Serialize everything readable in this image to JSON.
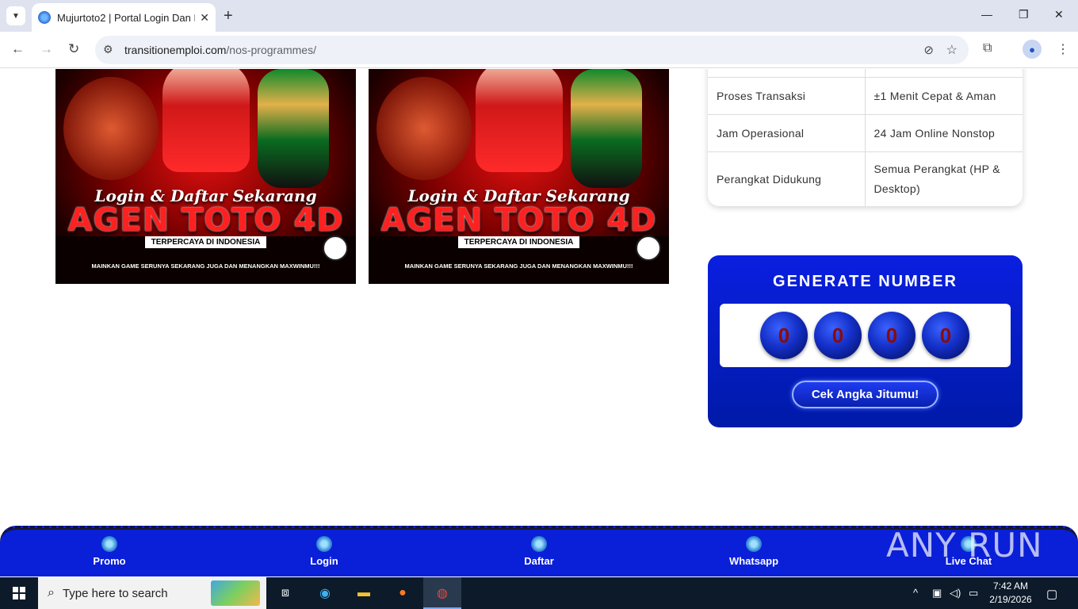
{
  "browser": {
    "tab_title": "Mujurtoto2 | Portal Login Dan D",
    "url_host": "transitionemploi.com",
    "url_path": "/nos-programmes/"
  },
  "banners": [
    {
      "script_text": "Login & Daftar Sekarang",
      "headline": "AGEN TOTO 4D",
      "tagline": "TERPERCAYA DI INDONESIA",
      "footer": "MAINKAN GAME SERUNYA SEKARANG JUGA DAN MENANGKAN MAXWINMU!!!"
    },
    {
      "script_text": "Login & Daftar Sekarang",
      "headline": "AGEN TOTO 4D",
      "tagline": "TERPERCAYA DI INDONESIA",
      "footer": "MAINKAN GAME SERUNYA SEKARANG JUGA DAN MENANGKAN MAXWINMU!!!"
    }
  ],
  "info_table": {
    "rows": [
      {
        "key": "",
        "value": ""
      },
      {
        "key": "Proses Transaksi",
        "value": "±1 Menit Cepat & Aman"
      },
      {
        "key": "Jam Operasional",
        "value": "24 Jam Online Nonstop"
      },
      {
        "key": "Perangkat Didukung",
        "value": "Semua Perangkat (HP & Desktop)"
      }
    ]
  },
  "generator": {
    "title": "GENERATE NUMBER",
    "digits": [
      "0",
      "0",
      "0",
      "0"
    ],
    "button_label": "Cek Angka Jitumu!"
  },
  "bottom_nav": {
    "items": [
      {
        "label": "Promo"
      },
      {
        "label": "Login"
      },
      {
        "label": "Daftar"
      },
      {
        "label": "Whatsapp"
      },
      {
        "label": "Live Chat"
      }
    ]
  },
  "watermark": "ANY RUN",
  "taskbar": {
    "search_placeholder": "Type here to search",
    "time": "7:42 AM",
    "date": "2/19/2026"
  }
}
